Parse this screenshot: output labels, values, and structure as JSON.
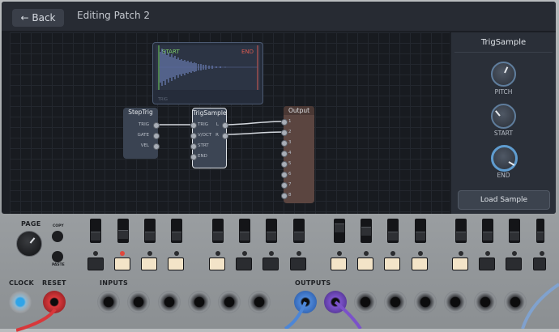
{
  "topbar": {
    "back_label": "← Back",
    "title": "Editing Patch 2"
  },
  "waveform": {
    "start_label": "START",
    "end_label": "END",
    "small_label": "TRIG"
  },
  "nodes": {
    "steptrig": {
      "title": "StepTrig",
      "ports": [
        "TRIG",
        "GATE",
        "VEL"
      ]
    },
    "trigsample": {
      "title": "TrigSample",
      "inputs": [
        "TRIG",
        "V/OCT",
        "STRT",
        "END"
      ],
      "outputs": [
        "L",
        "R"
      ]
    },
    "output": {
      "title": "Output",
      "ports": [
        "1",
        "2",
        "3",
        "4",
        "5",
        "6",
        "7",
        "8"
      ]
    }
  },
  "panel": {
    "title": "TrigSample",
    "knobs": [
      {
        "label": "PITCH",
        "color": "#5f7d9c"
      },
      {
        "label": "START",
        "color": "#5f7d9c"
      },
      {
        "label": "END",
        "color": "#5f9ccf"
      }
    ],
    "load_button": "Load Sample"
  },
  "hardware": {
    "page_label": "PAGE",
    "copy_label": "COPY",
    "paste_label": "PASTE",
    "clock_label": "CLOCK",
    "reset_label": "RESET",
    "inputs_label": "INPUTS",
    "outputs_label": "OUTPUTS"
  },
  "colors": {
    "accent_blue": "#4d86d6",
    "accent_purple": "#7b52c9",
    "accent_red": "#d8383b",
    "pad_lit": "#f3e4c8"
  }
}
